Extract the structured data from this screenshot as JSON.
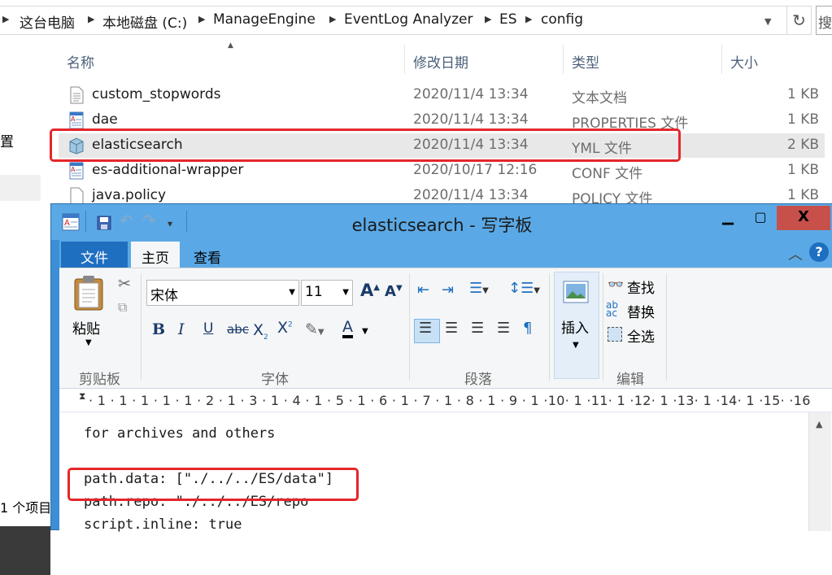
{
  "explorer": {
    "breadcrumb": [
      "这台电脑",
      "本地磁盘 (C:)",
      "ManageEngine",
      "EventLog Analyzer",
      "ES",
      "config"
    ],
    "columns": {
      "name": "名称",
      "modified": "修改日期",
      "type": "类型",
      "size": "大小"
    },
    "files": [
      {
        "name": "custom_stopwords",
        "modified": "2020/11/4 13:34",
        "type": "文本文档",
        "size": "1 KB",
        "icon": "text-file-icon"
      },
      {
        "name": "dae",
        "modified": "2020/11/4 13:34",
        "type": "PROPERTIES 文件",
        "size": "1 KB",
        "icon": "properties-file-icon"
      },
      {
        "name": "elasticsearch",
        "modified": "2020/11/4 13:34",
        "type": "YML 文件",
        "size": "2 KB",
        "icon": "yml-file-icon"
      },
      {
        "name": "es-additional-wrapper",
        "modified": "2020/10/17 12:16",
        "type": "CONF 文件",
        "size": "1 KB",
        "icon": "conf-file-icon"
      },
      {
        "name": "java.policy",
        "modified": "2020/11/4 13:34",
        "type": "POLICY 文件",
        "size": "1 KB",
        "icon": "policy-file-icon"
      }
    ],
    "left_label": "置",
    "status": "1 个项目"
  },
  "wordpad": {
    "title": "elasticsearch - 写字板",
    "tabs": {
      "file": "文件",
      "home": "主页",
      "view": "查看"
    },
    "clipboard": {
      "paste": "粘贴",
      "group": "剪贴板"
    },
    "font": {
      "family": "宋体",
      "size": "11",
      "group": "字体"
    },
    "paragraph": {
      "group": "段落"
    },
    "insert": {
      "label": "插入"
    },
    "editing": {
      "find": "查找",
      "replace": "替换",
      "select_all": "全选",
      "group": "编辑"
    },
    "ruler": "· 1 · 1 · 1 · 1 · 1 · 2 · 1 · 3 · 1 · 4 · 1 · 5 · 1 · 6 · 1 · 7 · 1 · 8 · 1 · 9 · 1 ·10· 1 ·11· 1 ·12· 1 ·13· 1 ·14· 1 ·15·  ·16",
    "lines": [
      "for archives and others",
      "",
      "path.data: [\"./../../ES/data\"]",
      "path.repo: \"./../../ES/repo",
      "script.inline: true"
    ]
  }
}
